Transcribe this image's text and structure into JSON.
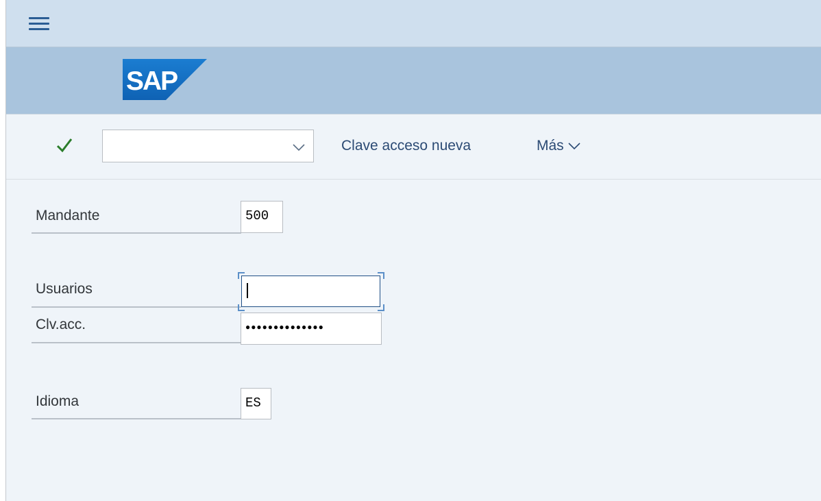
{
  "shell": {
    "menu_icon": "hamburger-menu-icon"
  },
  "brand": {
    "logo_text": "SAP",
    "logo_colors": [
      "#1b7dd1",
      "#0f62b4"
    ]
  },
  "toolbar": {
    "confirm_icon": "checkmark-icon",
    "confirm_color": "#2b7d2b",
    "combo_value": "",
    "combo_icon": "chevron-down-icon",
    "new_password_label": "Clave acceso nueva",
    "more_label": "Más",
    "more_icon": "chevron-down-icon"
  },
  "form": {
    "client": {
      "label": "Mandante",
      "value": "500"
    },
    "user": {
      "label": "Usuarios",
      "value": ""
    },
    "password": {
      "label": "Clv.acc.",
      "value": "●●●●●●●●●●●●●●"
    },
    "language": {
      "label": "Idioma",
      "value": "ES"
    }
  }
}
